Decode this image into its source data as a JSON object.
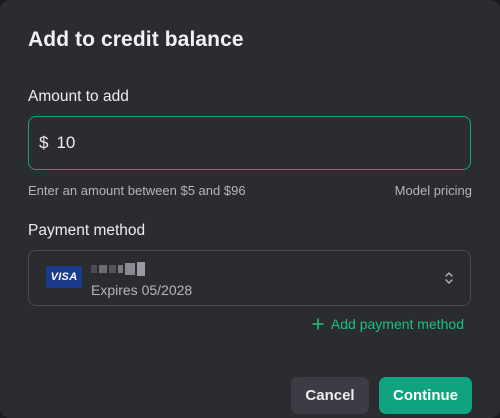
{
  "dialog": {
    "title": "Add to credit balance"
  },
  "amount": {
    "label": "Amount to add",
    "currency_symbol": "$",
    "value": "10",
    "hint": "Enter an amount between $5 and $96",
    "pricing_link": "Model pricing"
  },
  "payment": {
    "label": "Payment method",
    "card_brand": "VISA",
    "card_expiry": "Expires 05/2028",
    "add_method_label": "Add payment method"
  },
  "actions": {
    "cancel_label": "Cancel",
    "continue_label": "Continue"
  },
  "colors": {
    "accent": "#10a37f",
    "accent_text": "#19c37d",
    "background": "#2b2c30",
    "visa_blue": "#1a3a8f"
  },
  "icons": {
    "chevron": "chevron-up-down-icon",
    "add": "plus-icon",
    "card": "visa-card-icon"
  }
}
